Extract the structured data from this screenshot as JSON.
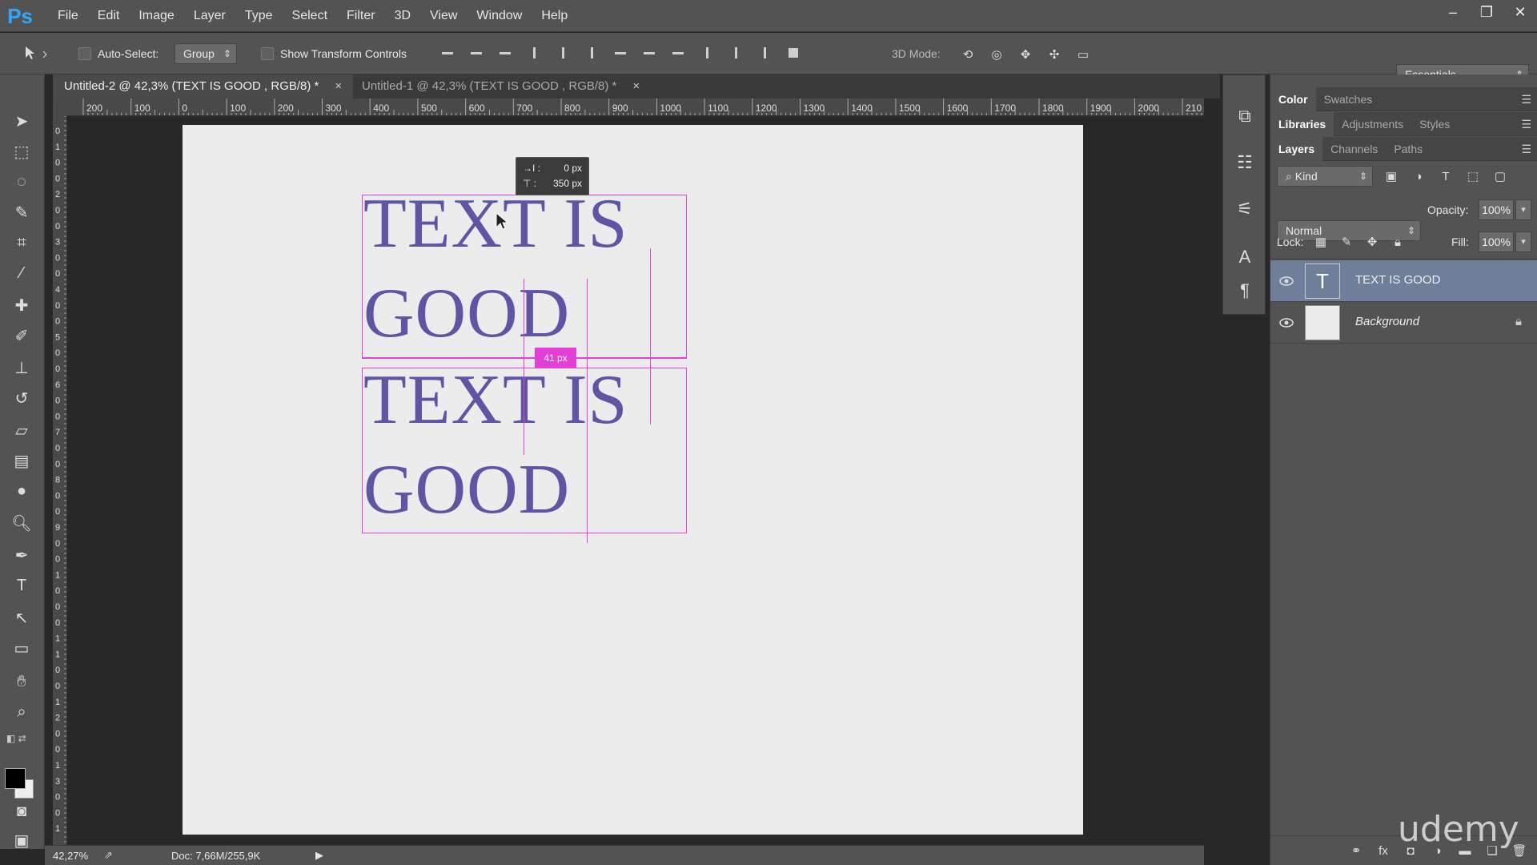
{
  "app": {
    "logo": "Ps"
  },
  "menu": [
    "File",
    "Edit",
    "Image",
    "Layer",
    "Type",
    "Select",
    "Filter",
    "3D",
    "View",
    "Window",
    "Help"
  ],
  "options": {
    "auto_select_label": "Auto-Select:",
    "auto_select_value": "Group",
    "show_transform_label": "Show Transform Controls",
    "mode_3d_label": "3D Mode:",
    "workspace": "Essentials"
  },
  "tabs": [
    {
      "label": "Untitled-2 @ 42,3% (TEXT IS GOOD  , RGB/8) *",
      "close": "×"
    },
    {
      "label": "Untitled-1 @ 42,3% (TEXT IS GOOD  , RGB/8) *",
      "close": "×"
    }
  ],
  "ruler": {
    "h": [
      "200",
      "100",
      "0",
      "100",
      "200",
      "300",
      "400",
      "500",
      "600",
      "700",
      "800",
      "900",
      "1000",
      "1100",
      "1200",
      "1300",
      "1400",
      "1500",
      "1600",
      "1700",
      "1800",
      "1900",
      "2000",
      "210"
    ],
    "v": [
      "0",
      "1",
      "0",
      "0",
      "2",
      "0",
      "0",
      "3",
      "0",
      "0",
      "4",
      "0",
      "0",
      "5",
      "0",
      "0",
      "6",
      "0",
      "0",
      "7",
      "0",
      "0",
      "8",
      "0",
      "0",
      "9",
      "0",
      "0",
      "1",
      "0",
      "0",
      "0",
      "1",
      "1",
      "0",
      "0",
      "1",
      "2",
      "0",
      "0",
      "1",
      "3",
      "0",
      "0",
      "1"
    ]
  },
  "canvas": {
    "line1": "TEXT IS",
    "line2": "GOOD",
    "line3": "TEXT IS",
    "line4": "GOOD",
    "text_color": "#5f54a6",
    "guide_color": "#e23fd6",
    "spacing_badge": "41 px",
    "tip_x_label": "→I :",
    "tip_x": "0 px",
    "tip_y_label": "⊤ :",
    "tip_y": "350 px"
  },
  "status": {
    "zoom": "42,27%",
    "doc": "Doc: 7,66M/255,9K"
  },
  "panels": {
    "top_tabs": [
      "Color",
      "Swatches"
    ],
    "mid_tabs": [
      "Libraries",
      "Adjustments",
      "Styles"
    ],
    "layers_tabs": [
      "Layers",
      "Channels",
      "Paths"
    ],
    "filter_kind": "Kind",
    "blend_mode": "Normal",
    "opacity_label": "Opacity:",
    "opacity": "100%",
    "lock_label": "Lock:",
    "fill_label": "Fill:",
    "fill": "100%",
    "layers": [
      {
        "name": "TEXT IS GOOD",
        "thumb": "T"
      },
      {
        "name": "Background"
      }
    ]
  },
  "watermark": "udemy"
}
